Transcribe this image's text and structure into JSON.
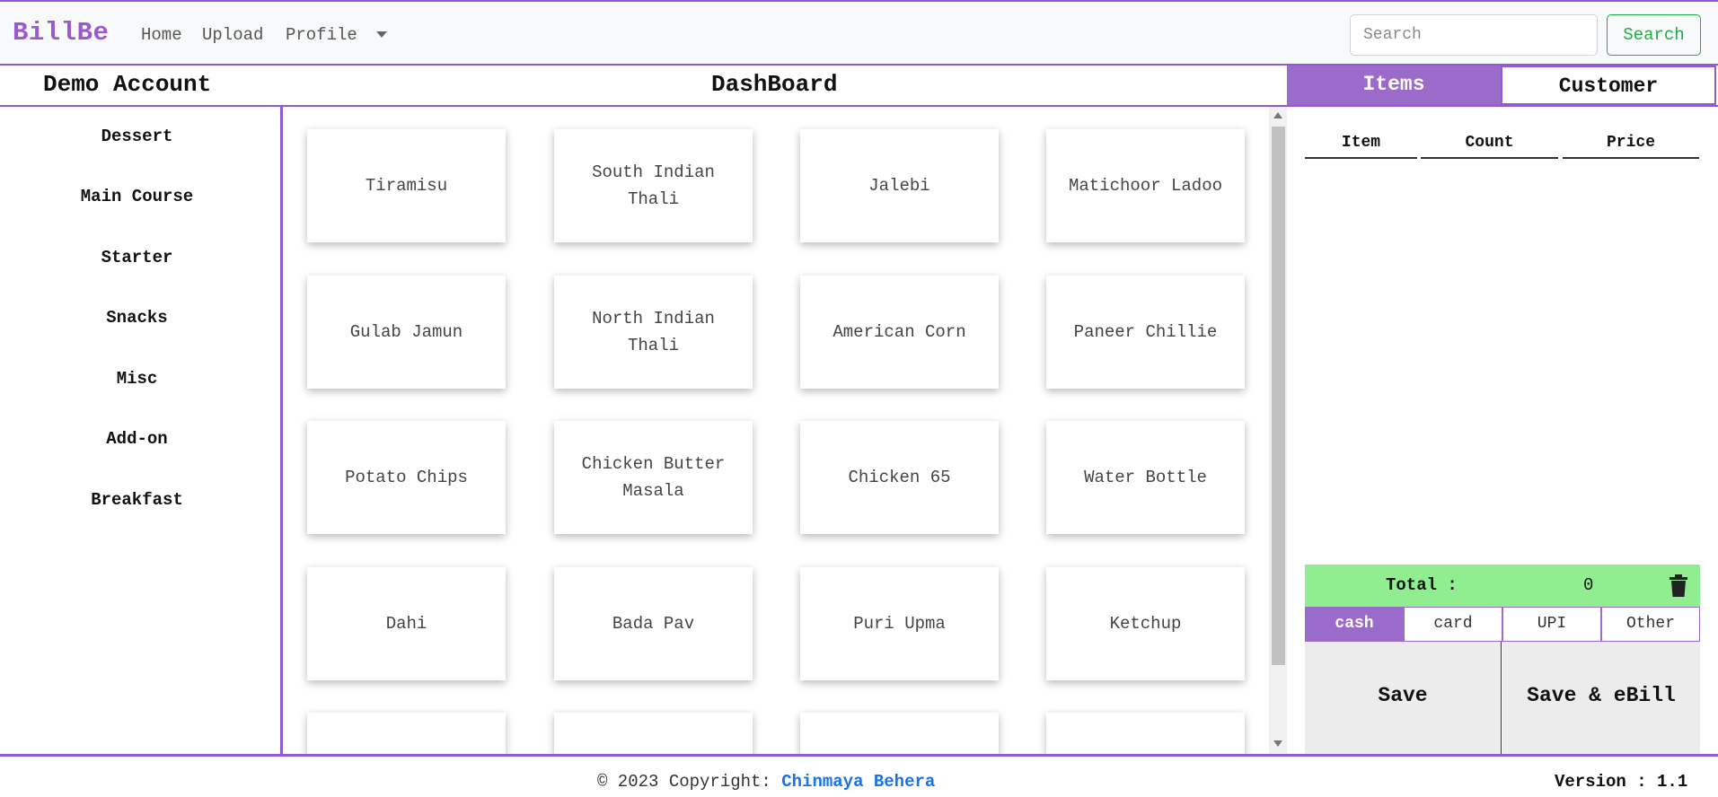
{
  "navbar": {
    "brand": "BillBe",
    "links": {
      "home": "Home",
      "upload": "Upload",
      "profile": "Profile"
    },
    "search": {
      "placeholder": "Search",
      "button": "Search"
    }
  },
  "header": {
    "account_name": "Demo Account",
    "title": "DashBoard",
    "tabs": {
      "items": "Items",
      "customer": "Customer"
    }
  },
  "sidebar": {
    "categories": [
      "Dessert",
      "Main Course",
      "Starter",
      "Snacks",
      "Misc",
      "Add-on",
      "Breakfast"
    ]
  },
  "menu_items": [
    "Tiramisu",
    "South Indian Thali",
    "Jalebi",
    "Matichoor Ladoo",
    "Gulab Jamun",
    "North Indian Thali",
    "American Corn",
    "Paneer Chillie",
    "Potato Chips",
    "Chicken Butter Masala",
    "Chicken 65",
    "Water Bottle",
    "Dahi",
    "Bada Pav",
    "Puri Upma",
    "Ketchup",
    "",
    "",
    "",
    ""
  ],
  "bill": {
    "columns": {
      "item": "Item",
      "count": "Count",
      "price": "Price"
    },
    "total_label": "Total :",
    "total_value": "0",
    "payment_methods": {
      "cash": "cash",
      "card": "card",
      "upi": "UPI",
      "other": "Other"
    },
    "actions": {
      "save": "Save",
      "save_ebill": "Save & eBill"
    }
  },
  "footer": {
    "copyright_prefix": "© 2023 Copyright:",
    "author": "Chinmaya Behera",
    "version": "Version : 1.1"
  },
  "colors": {
    "accent": "#9b6bcb",
    "brand": "#9b59d0",
    "total_bg": "#90ee90",
    "search_btn": "#28a745",
    "link": "#1a73e8"
  }
}
